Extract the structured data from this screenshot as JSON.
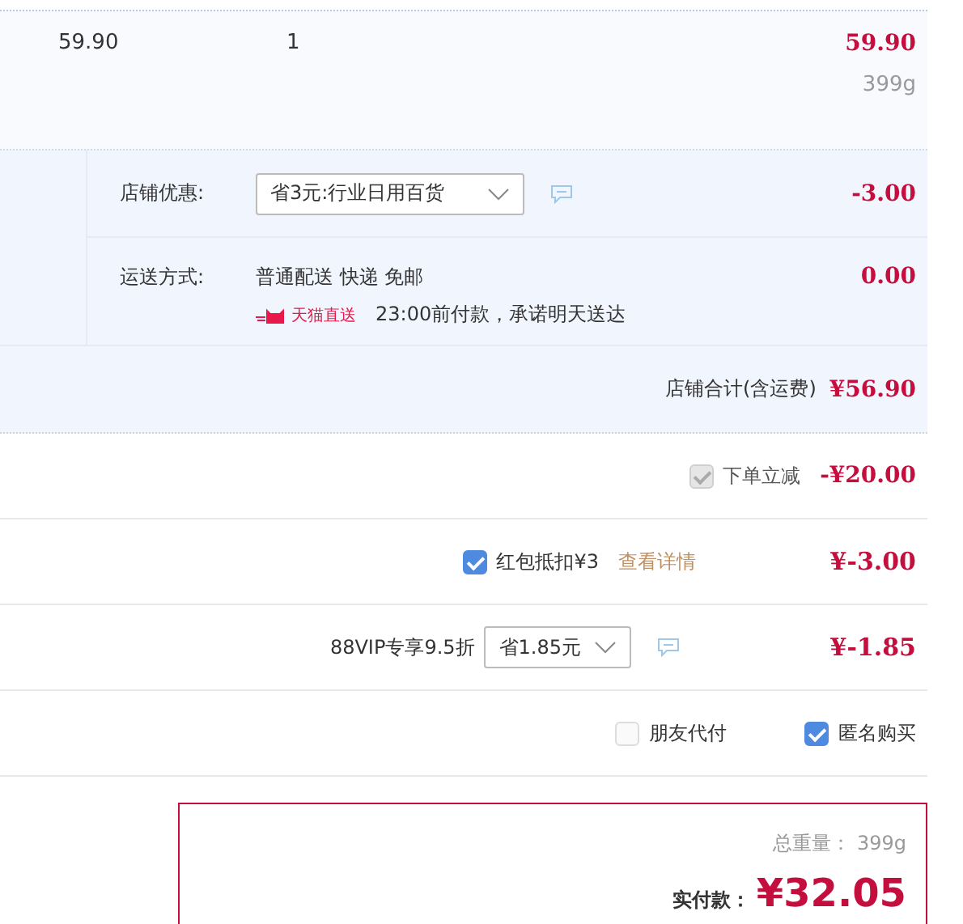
{
  "item": {
    "unit_price": "59.90",
    "quantity": "1",
    "subtotal": "59.90",
    "weight": "399g"
  },
  "store_discount": {
    "label": "店铺优惠:",
    "select": "省3元:行业日用百货",
    "amount": "-3.00"
  },
  "shipping": {
    "label": "运送方式:",
    "method": "普通配送 快递 免邮",
    "badge": "天猫直送",
    "promise": "23:00前付款，承诺明天送达",
    "amount": "0.00"
  },
  "store_total": {
    "label": "店铺合计(含运费)",
    "amount": "¥56.90"
  },
  "promotions": [
    {
      "kind": "checkbox",
      "label": "下单立减",
      "checked": true,
      "disabled": true,
      "amount": "-¥20.00"
    },
    {
      "kind": "checkbox",
      "label": "红包抵扣¥3",
      "link": "查看详情",
      "checked": true,
      "disabled": false,
      "amount": "¥-3.00"
    },
    {
      "kind": "select",
      "label": "88VIP专享9.5折",
      "select": "省1.85元",
      "amount": "¥-1.85"
    }
  ],
  "options": [
    {
      "label": "朋友代付",
      "checked": false
    },
    {
      "label": "匿名购买",
      "checked": true
    }
  ],
  "summary": {
    "weight_label": "总重量：",
    "weight": "399g",
    "pay_label": "实付款：",
    "pay": "¥32.05"
  }
}
